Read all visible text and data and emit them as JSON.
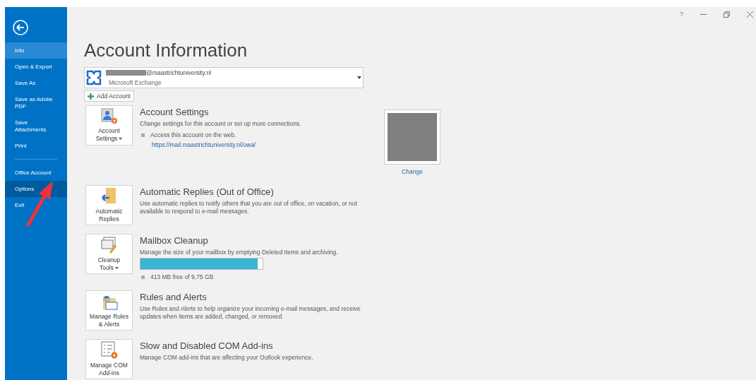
{
  "sidebar": {
    "items": [
      {
        "label": "Info",
        "selected": true,
        "highlighted": false,
        "kind": "item"
      },
      {
        "label": "Open & Export",
        "selected": false,
        "highlighted": false,
        "kind": "item"
      },
      {
        "label": "Save As",
        "selected": false,
        "highlighted": false,
        "kind": "item"
      },
      {
        "label": "Save as Adobe PDF",
        "selected": false,
        "highlighted": false,
        "kind": "item"
      },
      {
        "label": "Save Attachments",
        "selected": false,
        "highlighted": false,
        "kind": "item"
      },
      {
        "label": "Print",
        "selected": false,
        "highlighted": false,
        "kind": "item"
      },
      {
        "kind": "separator"
      },
      {
        "label": "Office Account",
        "selected": false,
        "highlighted": false,
        "kind": "item"
      },
      {
        "label": "Options",
        "selected": false,
        "highlighted": true,
        "kind": "item"
      },
      {
        "label": "Exit",
        "selected": false,
        "highlighted": false,
        "kind": "item"
      }
    ]
  },
  "window_controls": {
    "help": "?"
  },
  "title": "Account Information",
  "account": {
    "email": "@maastrichtuniversity.nl",
    "type": "Microsoft Exchange"
  },
  "add_account": "Add Account",
  "sections": [
    {
      "kind": "account",
      "button": "Account Settings",
      "dropdown": true,
      "heading": "Account Settings",
      "description": "Change settings for this account or set up more connections.",
      "bullet": "Access this account on the web.",
      "link": "https://mail.maastrichtuniversity.nl/owa/",
      "photo_link": "Change"
    },
    {
      "kind": "replies",
      "button": "Automatic Replies",
      "dropdown": false,
      "heading": "Automatic Replies (Out of Office)",
      "description": "Use automatic replies to notify others that you are out of office, on vacation, or not available to respond to e-mail messages."
    },
    {
      "kind": "cleanup",
      "button": "Cleanup Tools",
      "dropdown": true,
      "heading": "Mailbox Cleanup",
      "description": "Manage the size of your mailbox by emptying Deleted Items and archiving.",
      "level": 0.96,
      "bullet": "413 MB free of 9,75 GB"
    },
    {
      "kind": "rules",
      "button": "Manage Rules & Alerts",
      "dropdown": false,
      "heading": "Rules and Alerts",
      "description": "Use Rules and Alerts to help organize your incoming e-mail messages, and receive updates when items are added, changed, or removed."
    },
    {
      "kind": "addins",
      "button": "Manage COM Add-ins",
      "dropdown": false,
      "heading": "Slow and Disabled COM Add-ins",
      "description": "Manage COM add-ins that are affecting your Outlook experience."
    }
  ]
}
